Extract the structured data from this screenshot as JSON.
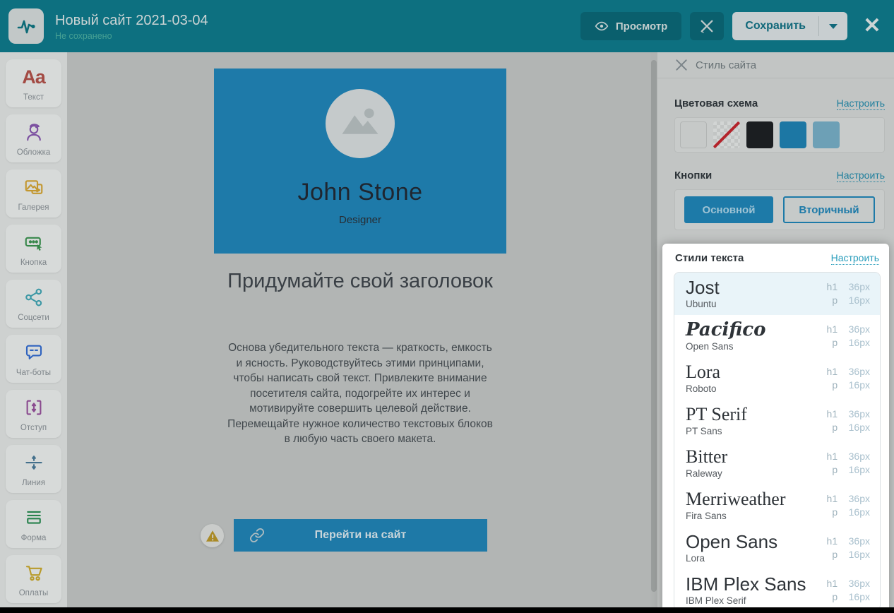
{
  "header": {
    "title": "Новый сайт 2021-03-04",
    "status": "Не сохранено",
    "preview_label": "Просмотр",
    "save_label": "Сохранить",
    "close_glyph": "✕",
    "logo_icon": "pulse-icon",
    "style_tool_icon": "crossed-tools-icon"
  },
  "sidebar": {
    "items": [
      {
        "label": "Текст",
        "icon": "text-icon",
        "color": "#a34b44"
      },
      {
        "label": "Обложка",
        "icon": "cover-icon",
        "color": "#7b4fa0"
      },
      {
        "label": "Галерея",
        "icon": "gallery-icon",
        "color": "#c39730"
      },
      {
        "label": "Кнопка",
        "icon": "button-icon",
        "color": "#37874a"
      },
      {
        "label": "Соцсети",
        "icon": "share-icon",
        "color": "#3d98a5"
      },
      {
        "label": "Чат-боты",
        "icon": "chatbot-icon",
        "color": "#2f63bf"
      },
      {
        "label": "Отступ",
        "icon": "spacing-icon",
        "color": "#8a4a8f"
      },
      {
        "label": "Линия",
        "icon": "line-icon",
        "color": "#44708c"
      },
      {
        "label": "Форма",
        "icon": "form-icon",
        "color": "#27824d"
      },
      {
        "label": "Оплаты",
        "icon": "cart-icon",
        "color": "#b99b2a"
      }
    ]
  },
  "canvas": {
    "profile_name": "John Stone",
    "profile_role": "Designer",
    "avatar_icon": "image-placeholder-icon",
    "heading": "Придумайте свой заголовок",
    "body": "Основа убедительного текста — краткость, емкость и ясность. Руководствуйтесь этими принципами, чтобы написать свой текст. Привлеките внимание посетителя сайта, подогрейте их интерес и мотивируйте совершить целевой действие. Перемещайте нужное количество текстовых блоков в любую часть своего макета.",
    "button_label": "Перейти на сайт",
    "warning_icon": "warning-triangle-icon",
    "link_icon": "link-icon"
  },
  "panel": {
    "title": "Стиль сайта",
    "configure_label": "Настроить",
    "color_scheme": {
      "title": "Цветовая схема",
      "swatches": [
        {
          "name": "swatch-light-gray",
          "color": "#c6c9c8"
        },
        {
          "name": "swatch-transparent-none",
          "color": "none"
        },
        {
          "name": "swatch-black",
          "color": "#1b1e21"
        },
        {
          "name": "swatch-blue",
          "color": "#1c77a4"
        },
        {
          "name": "swatch-light-blue",
          "color": "#6da0b6"
        }
      ]
    },
    "buttons": {
      "title": "Кнопки",
      "primary_label": "Основной",
      "secondary_label": "Вторичный"
    },
    "text_styles": {
      "title": "Стили текста",
      "h1_tag": "h1",
      "h1_size": "36px",
      "p_tag": "p",
      "p_size": "16px",
      "fonts": [
        {
          "heading": "Jost",
          "body": "Ubuntu",
          "style": "sans",
          "selected": true
        },
        {
          "heading": "Pacifico",
          "body": "Open Sans",
          "style": "script",
          "selected": false
        },
        {
          "heading": "Lora",
          "body": "Roboto",
          "style": "serif",
          "selected": false
        },
        {
          "heading": "PT Serif",
          "body": "PT Sans",
          "style": "serif",
          "selected": false
        },
        {
          "heading": "Bitter",
          "body": "Raleway",
          "style": "serif",
          "selected": false
        },
        {
          "heading": "Merriweather",
          "body": "Fira Sans",
          "style": "serif",
          "selected": false
        },
        {
          "heading": "Open Sans",
          "body": "Lora",
          "style": "sans",
          "selected": false
        },
        {
          "heading": "IBM Plex Sans",
          "body": "IBM Plex Serif",
          "style": "sans",
          "selected": false
        }
      ]
    }
  },
  "colors": {
    "header_teal": "#0d7080",
    "header_button_teal": "#0a5f6d",
    "accent_blue": "#1d7aa8",
    "selected_row_blue": "#e9f4f9",
    "link_teal": "#2a9ebc",
    "status_green": "#46a093",
    "warning_gold": "#aa8a25"
  }
}
